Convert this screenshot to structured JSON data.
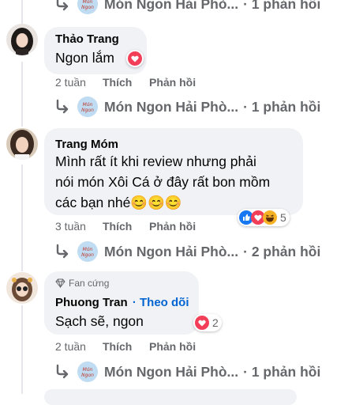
{
  "thread_top": {
    "page_name": "Món Ngon Hải Phò...",
    "reply_count": "· 1 phản hồi"
  },
  "actions": {
    "like": "Thích",
    "reply": "Phản hồi"
  },
  "comments": [
    {
      "author": "Thảo Trang",
      "text": "Ngon lắm",
      "time": "2 tuần",
      "reactions": {
        "icons": [
          "love-icon"
        ],
        "count": ""
      },
      "reply_preview": {
        "page_name": "Món Ngon Hải Phò...",
        "reply_count": "· 1 phản hồi"
      }
    },
    {
      "author": "Trang Móm",
      "text_lines": [
        "Mình rất ít khi review nhưng phải",
        "nói món Xôi Cá ở đây rất bon mồm",
        "các bạn nhé😊😊😊"
      ],
      "time": "3 tuần",
      "reactions": {
        "icons": [
          "like-icon",
          "love-icon",
          "haha-icon"
        ],
        "count": "5"
      },
      "reply_preview": {
        "page_name": "Món Ngon Hải Phò...",
        "reply_count": "· 2 phản hồi"
      }
    },
    {
      "badge": "Fan cứng",
      "author": "Phuong Tran",
      "follow": "· Theo dõi",
      "text": "Sạch sẽ, ngon",
      "time": "2 tuần",
      "reactions": {
        "icons": [
          "love-icon"
        ],
        "count": "2"
      },
      "reply_preview": {
        "page_name": "Món Ngon Hải Phò...",
        "reply_count": "· 1 phản hồi"
      }
    }
  ],
  "colors": {
    "bubble": "#f0f2f5",
    "secondary_text": "#65676b",
    "follow_link": "#0064d1",
    "love": "#f33e58",
    "like": "#1877f2",
    "haha": "#f7b125"
  }
}
